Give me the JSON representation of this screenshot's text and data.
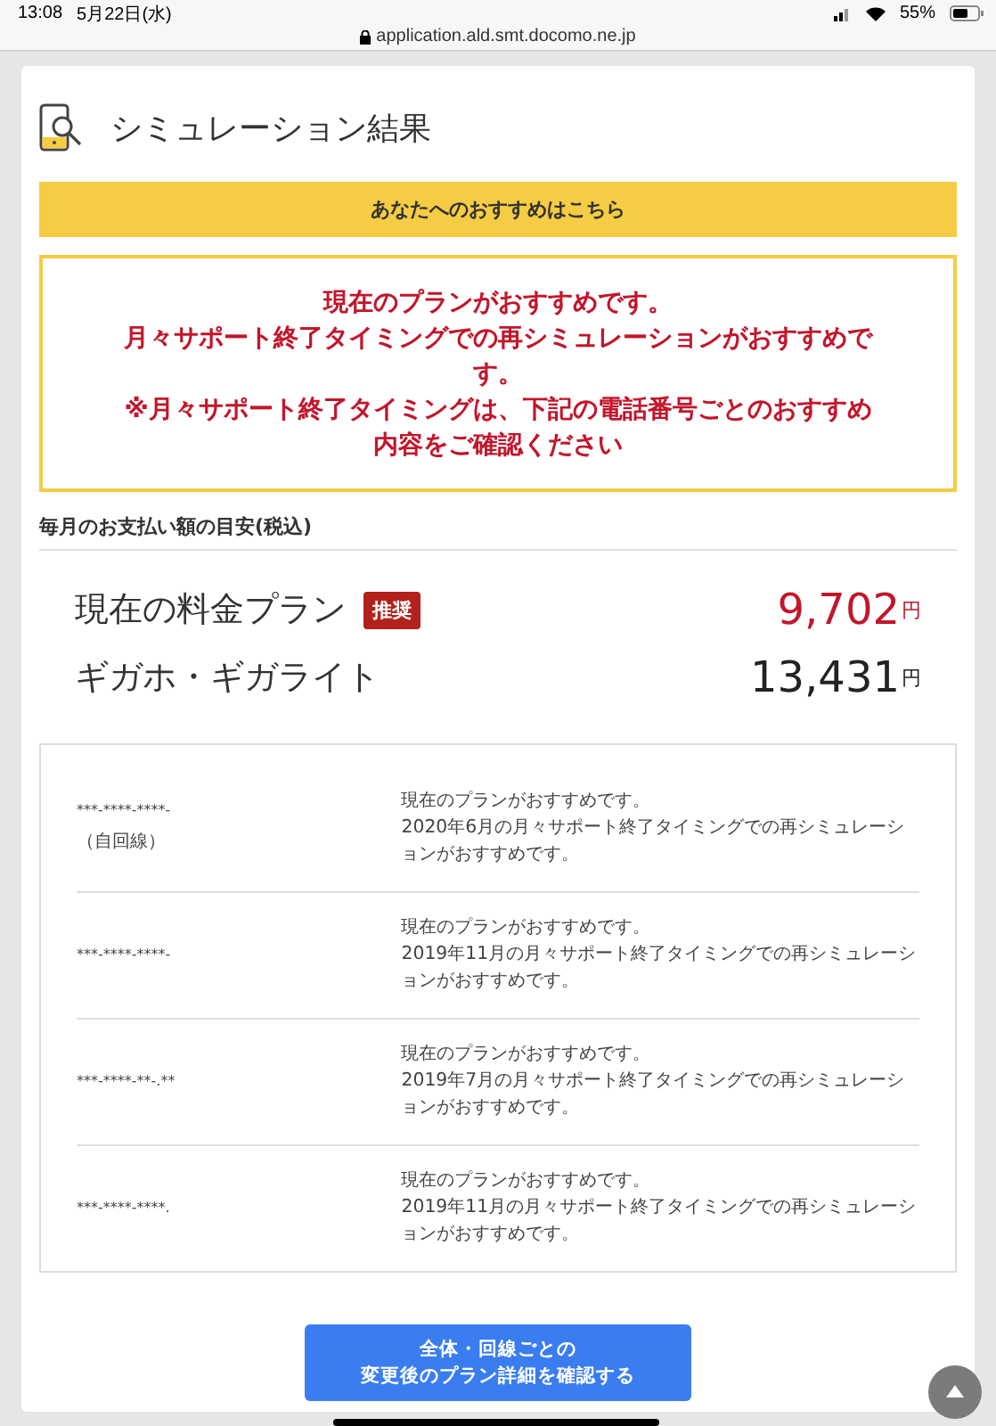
{
  "status_bar": {
    "time": "13:08",
    "date": "5月22日(水)",
    "battery": "55%",
    "url": "application.ald.smt.docomo.ne.jp"
  },
  "page_title": "シミュレーション結果",
  "recommend_banner": "あなたへのおすすめはこちら",
  "recommend_message": [
    "現在のプランがおすすめです。",
    "月々サポート終了タイミングでの再シミュレーションがおすすめです。",
    "※月々サポート終了タイミングは、下記の電話番号ごとのおすすめ内容をご確認ください"
  ],
  "section_label": "毎月のお支払い額の目安(税込)",
  "plans": [
    {
      "name": "現在の料金プラン",
      "badge": "推奨",
      "price": "9,702",
      "unit": "円",
      "recommended": true
    },
    {
      "name": "ギガホ・ギガライト",
      "price": "13,431",
      "unit": "円",
      "recommended": false
    }
  ],
  "lines": [
    {
      "number": "***-****-****-",
      "note": "（自回線）",
      "message": [
        "現在のプランがおすすめです。",
        "2020年6月の月々サポート終了タイミングでの再シミュレーションがおすすめです。"
      ]
    },
    {
      "number": "***-****-****-",
      "message": [
        "現在のプランがおすすめです。",
        "2019年11月の月々サポート終了タイミングでの再シミュレーションがおすすめです。"
      ]
    },
    {
      "number": "***-****-**-.**",
      "message": [
        "現在のプランがおすすめです。",
        "2019年7月の月々サポート終了タイミングでの再シミュレーションがおすすめです。"
      ]
    },
    {
      "number": "***-****-****.",
      "message": [
        "現在のプランがおすすめです。",
        "2019年11月の月々サポート終了タイミングでの再シミュレーションがおすすめです。"
      ]
    }
  ],
  "detail_button": [
    "全体・回線ごとの",
    "変更後のプラン詳細を確認する"
  ]
}
